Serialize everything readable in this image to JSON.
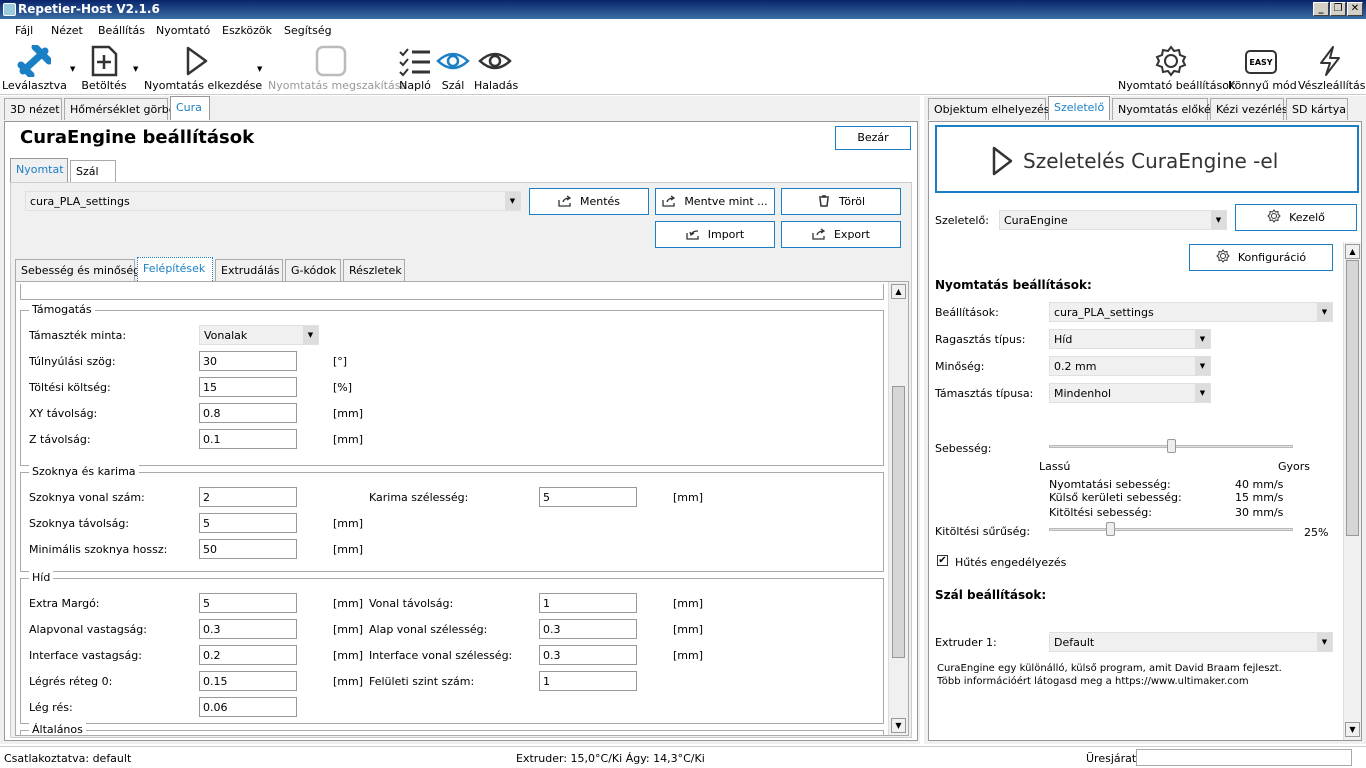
{
  "window": {
    "title": "Repetier-Host V2.1.6",
    "minimize": "_",
    "restore": "❐",
    "close": "✕"
  },
  "menu": [
    "Fájl",
    "Nézet",
    "Beállítás",
    "Nyomtató",
    "Eszközök",
    "Segítség"
  ],
  "toolbar": {
    "disconnect": "Leválasztva",
    "load": "Betöltés",
    "start_print": "Nyomtatás elkezdése",
    "stop_print": "Nyomtatás megszakítása",
    "log": "Napló",
    "filament": "Szál",
    "travel": "Haladás",
    "printer_settings": "Nyomtató beállítások",
    "easy_mode": "Könnyű mód",
    "easy_badge": "EASY",
    "emergency_stop": "Vészleállítás"
  },
  "left_tabs": [
    "3D nézet",
    "Hőmérséklet görbe",
    "Cura"
  ],
  "cura": {
    "title": "CuraEngine beállítások",
    "close_button": "Bezár",
    "sub_tabs": [
      "Nyomtat",
      "Szál"
    ],
    "profile": "cura_PLA_settings",
    "save": "Mentés",
    "save_as": "Mentve mint ...",
    "delete": "Töröl",
    "import": "Import",
    "export": "Export",
    "settings_tabs": [
      "Sebesség és minőség",
      "Felépítések",
      "Extrudálás",
      "G-kódok",
      "Részletek"
    ]
  },
  "support": {
    "title": "Támogatás",
    "pattern_label": "Támaszték minta:",
    "pattern_value": "Vonalak",
    "overhang_label": "Túlnyúlási szög:",
    "overhang_value": "30",
    "overhang_unit": "[°]",
    "fill_cost_label": "Töltési költség:",
    "fill_cost_value": "15",
    "fill_cost_unit": "[%]",
    "xy_label": "XY távolság:",
    "xy_value": "0.8",
    "xy_unit": "[mm]",
    "z_label": "Z távolság:",
    "z_value": "0.1",
    "z_unit": "[mm]"
  },
  "skirt": {
    "title": "Szoknya és karima",
    "lines_label": "Szoknya vonal szám:",
    "lines_value": "2",
    "brim_label": "Karima szélesség:",
    "brim_value": "5",
    "brim_unit": "[mm]",
    "distance_label": "Szoknya távolság:",
    "distance_value": "5",
    "distance_unit": "[mm]",
    "minlen_label": "Minimális szoknya hossz:",
    "minlen_value": "50",
    "minlen_unit": "[mm]"
  },
  "bridge": {
    "title": "Híd",
    "extra_margin_label": "Extra Margó:",
    "extra_margin_value": "5",
    "extra_margin_unit": "[mm]",
    "line_dist_label": "Vonal távolság:",
    "line_dist_value": "1",
    "line_dist_unit": "[mm]",
    "base_thick_label": "Alapvonal vastagság:",
    "base_thick_value": "0.3",
    "base_thick_unit": "[mm]",
    "base_width_label": "Alap vonal szélesség:",
    "base_width_value": "0.3",
    "base_width_unit": "[mm]",
    "iface_thick_label": "Interface vastagság:",
    "iface_thick_value": "0.2",
    "iface_thick_unit": "[mm]",
    "iface_width_label": "Interface vonal szélesség:",
    "iface_width_value": "0.3",
    "iface_width_unit": "[mm]",
    "airgap_label": "Légrés réteg 0:",
    "airgap_value": "0.15",
    "airgap_unit": "[mm]",
    "surface_label": "Felületi szint szám:",
    "surface_value": "1",
    "gap_label": "Lég rés:",
    "gap_value": "0.06"
  },
  "general_partial": "Általános",
  "right_tabs": [
    "Objektum elhelyezése",
    "Szeletelő",
    "Nyomtatás előkép",
    "Kézi vezérlés",
    "SD kártya"
  ],
  "slicer": {
    "slice_button": "Szeletelés CuraEngine -el",
    "slicer_label": "Szeletelő:",
    "slicer_value": "CuraEngine",
    "manage_button": "Kezelő",
    "config_button": "Konfiguráció",
    "print_settings_heading": "Nyomtatás beállítások:",
    "settings_label": "Beállítások:",
    "settings_value": "cura_PLA_settings",
    "adhesion_label": "Ragasztás típus:",
    "adhesion_value": "Híd",
    "quality_label": "Minőség:",
    "quality_value": "0.2 mm",
    "support_label": "Támasztás típusa:",
    "support_value": "Mindenhol",
    "speed_label": "Sebesség:",
    "slow": "Lassú",
    "fast": "Gyors",
    "speed_level": 0.5,
    "print_speed_label": "Nyomtatási sebesség:",
    "print_speed_value": "40 mm/s",
    "outer_speed_label": "Külső kerületi sebesség:",
    "outer_speed_value": "15 mm/s",
    "infill_speed_label": "Kitöltési sebesség:",
    "infill_speed_value": "30 mm/s",
    "density_label": "Kitöltési sűrűség:",
    "density_value": "25%",
    "density_level": 0.25,
    "cooling_label": "Hűtés engedélyezés",
    "cooling_checked": true,
    "filament_heading": "Szál beállítások:",
    "extruder_label": "Extruder 1:",
    "extruder_value": "Default",
    "info": "CuraEngine egy különálló, külső program, amit David Braam fejleszt. Több információért látogasd meg a https://www.ultimaker.com"
  },
  "status": {
    "connection": "Csatlakoztatva: default",
    "temps": "Extruder: 15,0°C/Ki Ágy: 14,3°C/Ki",
    "idle": "Üresjárat"
  },
  "colors": {
    "accent": "#1a7fc4",
    "title_start": "#0a246a",
    "title_end": "#3a6ea5",
    "disabled": "#999999"
  }
}
